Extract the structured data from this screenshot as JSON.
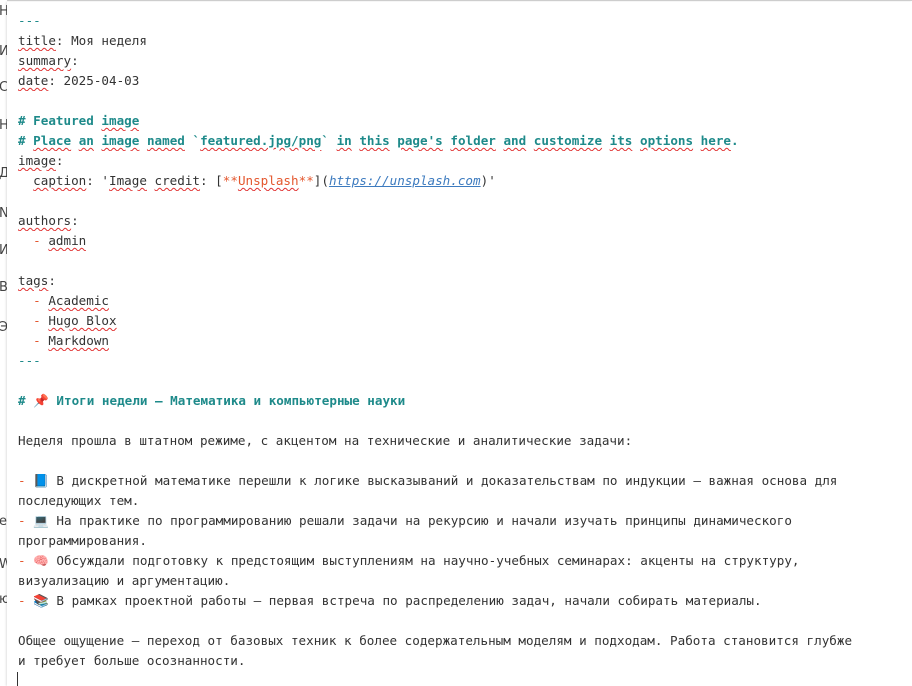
{
  "background": {
    "fragments": [
      "Н",
      "И",
      "С",
      "Н",
      "Д",
      "N",
      "И",
      "В",
      "Э",
      "е",
      "W",
      "ю"
    ]
  },
  "editor": {
    "fm_open": "---",
    "title_key": "title",
    "title_val": ": Моя неделя",
    "summary_key": "summary",
    "summary_rest": ":",
    "date_key": "date",
    "date_val": ": 2025-04-03",
    "featured_hash": "# Featured ",
    "featured_word": "image",
    "place_hash": "# ",
    "place_w1": "Place",
    "place_sp1": " ",
    "place_w2": "an",
    "place_sp2": " ",
    "place_w3": "image",
    "place_sp3": " ",
    "place_w4": "named",
    "place_sp4": " `",
    "place_w5": "featured.jpg/png",
    "place_sp5": "` ",
    "place_w6": "in",
    "place_sp6": " ",
    "place_w7": "this",
    "place_sp7": " ",
    "place_w8": "page's",
    "place_sp8": " ",
    "place_w9": "folder",
    "place_sp9": " ",
    "place_w10": "and",
    "place_sp10": " ",
    "place_w11": "customize",
    "place_sp11": " ",
    "place_w12": "its",
    "place_sp12": " ",
    "place_w13": "options",
    "place_sp13": " ",
    "place_w14": "here",
    "place_end": ".",
    "image_key": "image",
    "image_rest": ":",
    "caption_key": "caption",
    "caption_colon": ": '",
    "caption_w1": "Image",
    "caption_sp": " ",
    "caption_w2": "credit",
    "caption_mid": ": [",
    "caption_stars1": "**",
    "caption_w3": "Unsplash",
    "caption_stars2": "**",
    "caption_paren": "](",
    "caption_url": "https://unsplash.com",
    "caption_end": ")'",
    "authors_key": "authors",
    "authors_rest": ":",
    "dash": "  - ",
    "author1": "admin",
    "tags_key": "tags",
    "tags_rest": ":",
    "tag1": "Academic",
    "tag2": "Hugo Blox",
    "tag3": "Markdown",
    "fm_close": "---",
    "h1": "# 📌 Итоги недели — Математика и компьютерные науки",
    "intro": "Неделя прошла в штатном режиме, с акцентом на технические и аналитические задачи:",
    "li_dash": "- ",
    "b1a": "📘 В дискретной математике перешли к логике высказываний и доказательствам по индукции — важная основа для",
    "b1b": "последующих тем.",
    "b2a": "💻 На практике по программированию решали задачи на рекурсию и начали изучать принципы динамического",
    "b2b": "программирования.",
    "b3a": "🧠 Обсуждали подготовку к предстоящим выступлениям на научно-учебных семинарах: акценты на структуру,",
    "b3b": "визуализацию и аргументацию.",
    "b4": "📚 В рамках проектной работы — первая встреча по распределению задач, начали собирать материалы.",
    "outro_a": "Общее ощущение — переход от базовых техник к более содержательным моделям и подходам. Работа становится глубже",
    "outro_b": "и требует больше осознанности."
  },
  "colors": {
    "accent": "#1e8a8a",
    "list_marker": "#e4572e",
    "link": "#3d7bbf",
    "spellcheck": "#e03030",
    "text": "#333333"
  }
}
